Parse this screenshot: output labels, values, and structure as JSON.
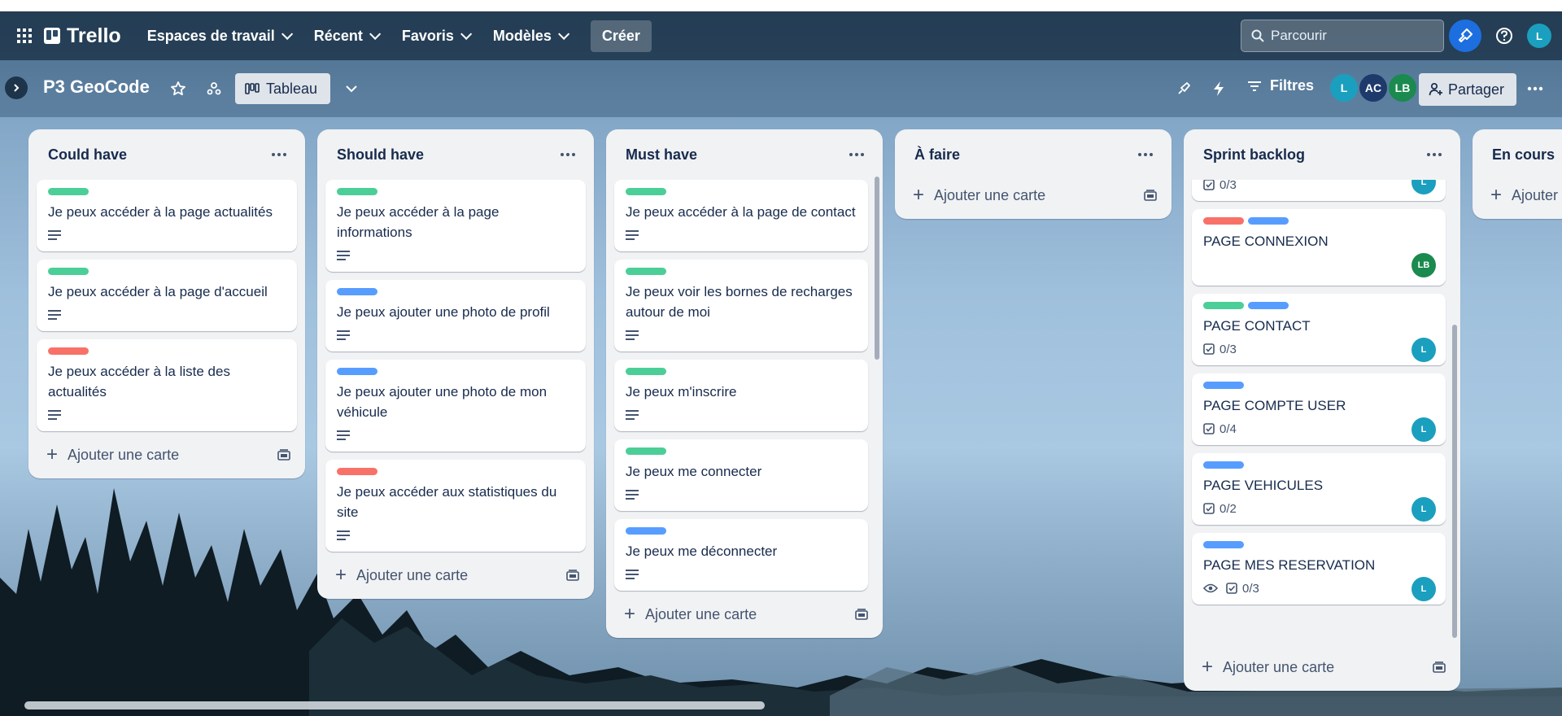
{
  "header": {
    "apps_icon": "apps-grid-icon",
    "logo_text": "Trello",
    "nav": [
      {
        "label": "Espaces de travail"
      },
      {
        "label": "Récent"
      },
      {
        "label": "Favoris"
      },
      {
        "label": "Modèles"
      }
    ],
    "create_label": "Créer",
    "search_placeholder": "Parcourir",
    "user_initial": "L"
  },
  "board": {
    "title": "P3 GeoCode",
    "view_label": "Tableau",
    "filters_label": "Filtres",
    "share_label": "Partager",
    "members": [
      {
        "initials": "L",
        "color": "#1b9fbf"
      },
      {
        "initials": "AC",
        "color": "#1d3a6b"
      },
      {
        "initials": "LB",
        "color": "#1a8a4f"
      }
    ]
  },
  "colors": {
    "green": "#4bce97",
    "blue": "#579dff",
    "red": "#f87168",
    "teal_avatar": "#1b9fbf",
    "green_avatar": "#1a8a4f"
  },
  "lists": [
    {
      "title": "Could have",
      "add_label": "Ajouter une carte",
      "cards": [
        {
          "labels": [
            "green"
          ],
          "title": "Je peux accéder à la page actualités",
          "description": true
        },
        {
          "labels": [
            "green"
          ],
          "title": "Je peux accéder à la page d'accueil",
          "description": true
        },
        {
          "labels": [
            "red"
          ],
          "title": "Je peux accéder à la liste des actualités",
          "description": true
        }
      ]
    },
    {
      "title": "Should have",
      "add_label": "Ajouter une carte",
      "cards": [
        {
          "labels": [
            "green"
          ],
          "title": "Je peux accéder à la page informations",
          "description": true
        },
        {
          "labels": [
            "blue"
          ],
          "title": "Je peux ajouter une photo de profil",
          "description": true
        },
        {
          "labels": [
            "blue"
          ],
          "title": "Je peux ajouter une photo de mon véhicule",
          "description": true
        },
        {
          "labels": [
            "red"
          ],
          "title": "Je peux accéder aux statistiques du site",
          "description": true
        }
      ]
    },
    {
      "title": "Must have",
      "add_label": "Ajouter une carte",
      "cards": [
        {
          "labels": [
            "green"
          ],
          "title": "Je peux accéder à la page de contact",
          "description": true
        },
        {
          "labels": [
            "green"
          ],
          "title": "Je peux voir les bornes de recharges autour de moi",
          "description": true
        },
        {
          "labels": [
            "green"
          ],
          "title": "Je peux m'inscrire",
          "description": true
        },
        {
          "labels": [
            "green"
          ],
          "title": "Je peux me connecter",
          "description": true
        },
        {
          "labels": [
            "blue"
          ],
          "title": "Je peux me déconnecter",
          "description": true
        }
      ]
    },
    {
      "title": "À faire",
      "add_label": "Ajouter une carte",
      "cards": []
    },
    {
      "title": "Sprint backlog",
      "add_label": "Ajouter une carte",
      "cards": [
        {
          "labels": [],
          "title": "",
          "checklist": "0/3",
          "member": "L"
        },
        {
          "labels": [
            "red",
            "blue"
          ],
          "title": "PAGE CONNEXION",
          "member": "LB"
        },
        {
          "labels": [
            "green",
            "blue"
          ],
          "title": "PAGE CONTACT",
          "checklist": "0/3",
          "member": "L"
        },
        {
          "labels": [
            "blue"
          ],
          "title": "PAGE COMPTE USER",
          "checklist": "0/4",
          "member": "L"
        },
        {
          "labels": [
            "blue"
          ],
          "title": "PAGE VEHICULES",
          "checklist": "0/2",
          "member": "L"
        },
        {
          "labels": [
            "blue"
          ],
          "title": "PAGE MES RESERVATION",
          "watching": true,
          "checklist": "0/3",
          "member": "L"
        }
      ]
    },
    {
      "title": "En cours",
      "add_label": "Ajouter"
    }
  ]
}
